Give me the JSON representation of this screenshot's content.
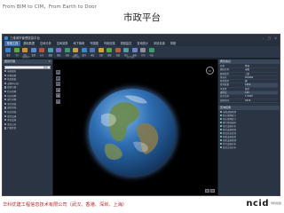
{
  "slide": {
    "top_text": "From BIM to CIM，From Earth to Door",
    "title": "市政平台",
    "footer_company": "华科优建工程信息技术有限公司（武汉、香港、深圳、上海）",
    "footer_logo_word": "ncid",
    "footer_logo_sub": "华科优建"
  },
  "app": {
    "window_title": "三维城市管理信息平台",
    "menu_tabs": [
      "常用工具",
      "基础数据",
      "空间分析",
      "空间量算",
      "地下管网",
      "专题图",
      "市政设施",
      "视频监控",
      "查询统计",
      "系统设置",
      "帮助"
    ],
    "active_tab_index": 0,
    "ribbon_buttons": [
      {
        "label": "漫游",
        "color": "#3b86c9"
      },
      {
        "label": "飞行",
        "color": "#58a64a"
      },
      {
        "label": "定位",
        "color": "#d6902b"
      },
      {
        "label": "量测",
        "color": "#5a8bd0"
      },
      {
        "label": "标注",
        "color": "#c04f3d"
      },
      {
        "label": "截图",
        "color": "#4aa0a6"
      },
      {
        "label": "图层",
        "color": "#7b6cc4"
      },
      {
        "label": "剖面",
        "color": "#3a9b6c"
      },
      {
        "label": "通视",
        "color": "#c7a23c"
      },
      {
        "label": "缓冲",
        "color": "#3b86c9"
      },
      {
        "label": "淹没",
        "color": "#4d78b8"
      },
      {
        "label": "日照",
        "color": "#d6a02b"
      },
      {
        "label": "视域",
        "color": "#58a64a"
      },
      {
        "label": "挖填",
        "color": "#b85d3c"
      },
      {
        "label": "统计",
        "color": "#4aa0a6"
      },
      {
        "label": "报表",
        "color": "#6b84c6"
      },
      {
        "label": "打印",
        "color": "#8a8f98"
      },
      {
        "label": "导出",
        "color": "#3a9b6c"
      }
    ],
    "ribbon_groups": [
      "基础操作",
      "空间分析",
      "统计输出"
    ],
    "left_panel": {
      "title": "图层管理",
      "search_value": "搜索",
      "items": [
        "基础图层",
        "影像底图",
        "地形数据",
        "道路中心线",
        "建筑白模",
        "给水管网",
        "排水管网",
        "燃气管网",
        "电力管线",
        "通信管线",
        "热力管线",
        "路灯设施",
        "井盖设施",
        "监控点位",
        "行政区划"
      ]
    },
    "viewer": {
      "tools": [
        "+",
        "−",
        "⌂",
        "⟲",
        "✥",
        "◎"
      ],
      "compass": "N"
    },
    "right_panel": {
      "props_title": "属性信息",
      "props": [
        {
          "k": "名称",
          "v": "区域"
        },
        {
          "k": "图层名称",
          "v": "市政"
        },
        {
          "k": "数据类型",
          "v": "三维"
        },
        {
          "k": "坐标系",
          "v": "WGS84"
        },
        {
          "k": "要素类型",
          "v": "面"
        },
        {
          "k": "要素数量",
          "v": "1250"
        },
        {
          "k": "可见性",
          "v": "显示"
        },
        {
          "k": "透明度",
          "v": "100"
        },
        {
          "k": "显示比例",
          "v": "1:5000"
        },
        {
          "k": "更新时间",
          "v": "2018"
        }
      ],
      "list_title": "查询结果",
      "list_items": [
        "市政道路管理",
        "给水管网统计",
        "排水管网统计",
        "燃气管线巡检",
        "电力设施分布",
        "路灯设施管理",
        "井盖信息查询",
        "桥梁设施巡查",
        "绿化设施管理",
        "环卫设施分布",
        "监控点位分布"
      ]
    }
  }
}
